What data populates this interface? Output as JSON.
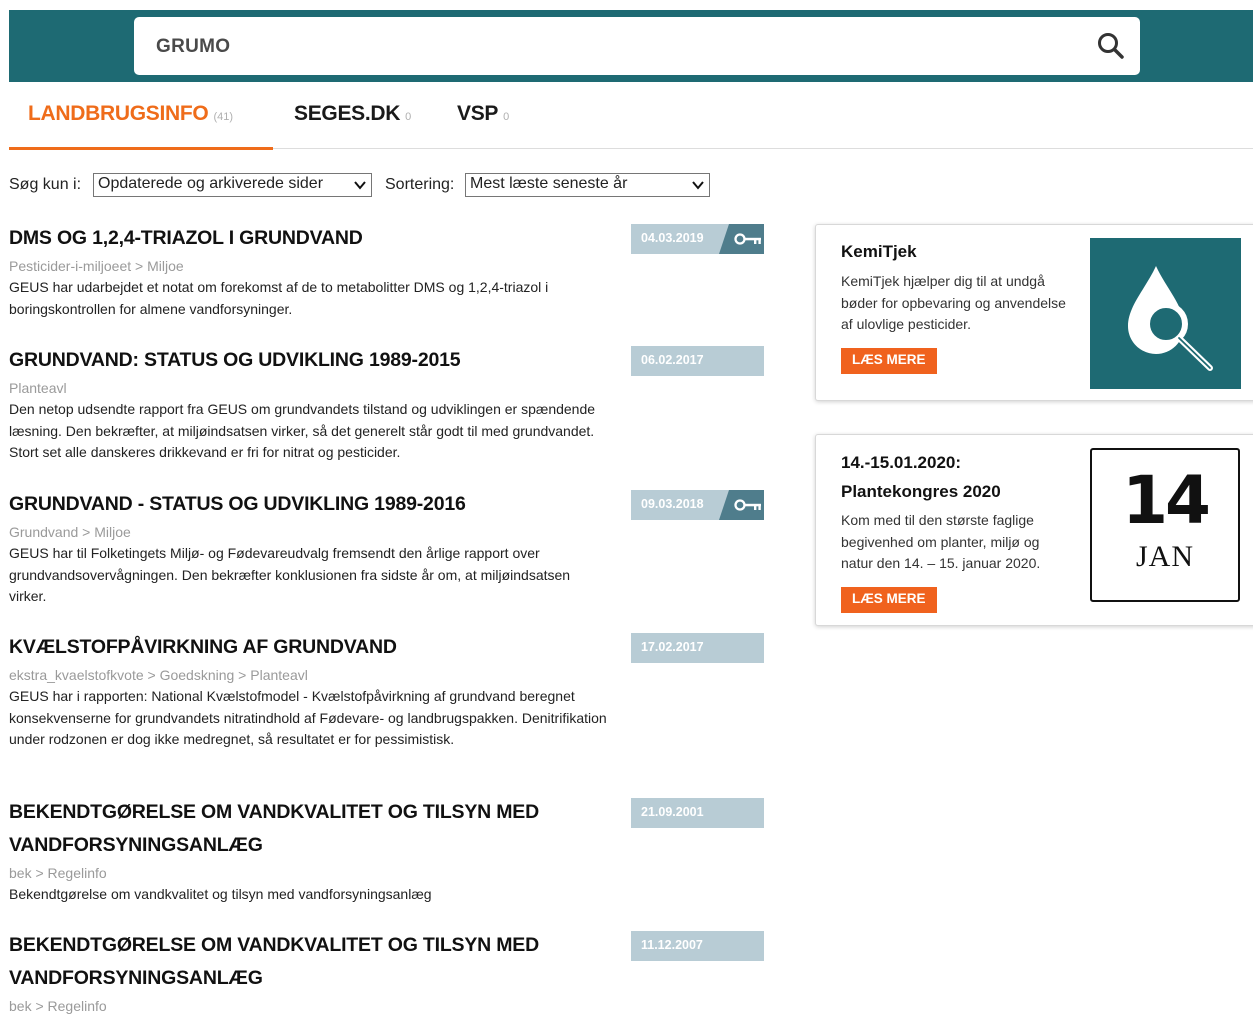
{
  "search": {
    "value": "GRUMO"
  },
  "tabs": [
    {
      "label": "LANDBRUGSINFO",
      "count": "(41)"
    },
    {
      "label": "SEGES.DK",
      "count": "0"
    },
    {
      "label": "VSP",
      "count": "0"
    }
  ],
  "filters": {
    "scope_label": "Søg kun i:",
    "scope_value": "Opdaterede og arkiverede sider",
    "sort_label": "Sortering:",
    "sort_value": "Mest læste seneste år"
  },
  "results": [
    {
      "title": "DMS OG 1,2,4-TRIAZOL I GRUNDVAND",
      "path": "Pesticider-i-miljoeet > Miljoe",
      "desc": "GEUS har udarbejdet et notat om forekomst af de to metabolitter DMS og 1,2,4-triazol i boringskontrollen for almene vandforsyninger.",
      "date": "04.03.2019",
      "locked": true
    },
    {
      "title": "GRUNDVAND: STATUS OG UDVIKLING 1989-2015",
      "path": "Planteavl",
      "desc": "Den netop udsendte rapport fra GEUS om grundvandets tilstand og udviklingen er spændende læsning. Den bekræfter, at miljøindsatsen virker, så det generelt står godt til med grundvandet. Stort set alle danskeres drikkevand er fri for nitrat og pesticider.",
      "date": "06.02.2017",
      "locked": false
    },
    {
      "title": "GRUNDVAND - STATUS OG UDVIKLING 1989-2016",
      "path": "Grundvand > Miljoe",
      "desc": "GEUS har til Folketingets Miljø- og Fødevareudvalg fremsendt den årlige rapport over grundvandsovervågningen. Den bekræfter konklusionen fra sidste år om, at miljøindsatsen virker.",
      "date": "09.03.2018",
      "locked": true
    },
    {
      "title": "KVÆLSTOFPÅVIRKNING AF GRUNDVAND",
      "path": "ekstra_kvaelstofkvote > Goedskning > Planteavl",
      "desc": "GEUS har i rapporten: National Kvælstofmodel - Kvælstofpåvirkning af grundvand beregnet konsekvenserne for grundvandets nitratindhold af Fødevare- og landbrugspakken. Denitrifikation under rodzonen er dog ikke medregnet, så resultatet er for pessimistisk.",
      "date": "17.02.2017",
      "locked": false
    },
    {
      "title": "BEKENDTGØRELSE OM VANDKVALITET OG TILSYN MED VANDFORSYNINGSANLÆG",
      "path": "bek > Regelinfo",
      "desc": "Bekendtgørelse om vandkvalitet og tilsyn med vandforsyningsanlæg",
      "date": "21.09.2001",
      "locked": false
    },
    {
      "title": "BEKENDTGØRELSE OM VANDKVALITET OG TILSYN MED VANDFORSYNINGSANLÆG",
      "path": "bek > Regelinfo",
      "desc": "",
      "date": "11.12.2007",
      "locked": false
    }
  ],
  "cards": {
    "kemitjek": {
      "title": "KemiTjek",
      "desc": "KemiTjek hjælper dig til at undgå bøder for opbevaring og anvendelse af ulovlige pesticider.",
      "button": "LÆS MERE"
    },
    "event": {
      "title_line1": "14.-15.01.2020:",
      "title_line2": "Plantekongres 2020",
      "desc": "Kom med til den største faglige begivenhed om planter, miljø og natur den 14. – 15. januar 2020.",
      "button": "LÆS MERE",
      "cal_day": "14",
      "cal_month": "JAN"
    }
  },
  "colors": {
    "brand_teal": "#1e6a73",
    "accent_orange": "#ef6c1a",
    "date_badge": "#b8ccd5",
    "key_tab": "#4f7d8c"
  },
  "icons": {
    "search": "search-icon",
    "key": "key-icon",
    "dropdown": "chevron-down-icon",
    "kemitjek": "drop-magnifier-icon"
  }
}
